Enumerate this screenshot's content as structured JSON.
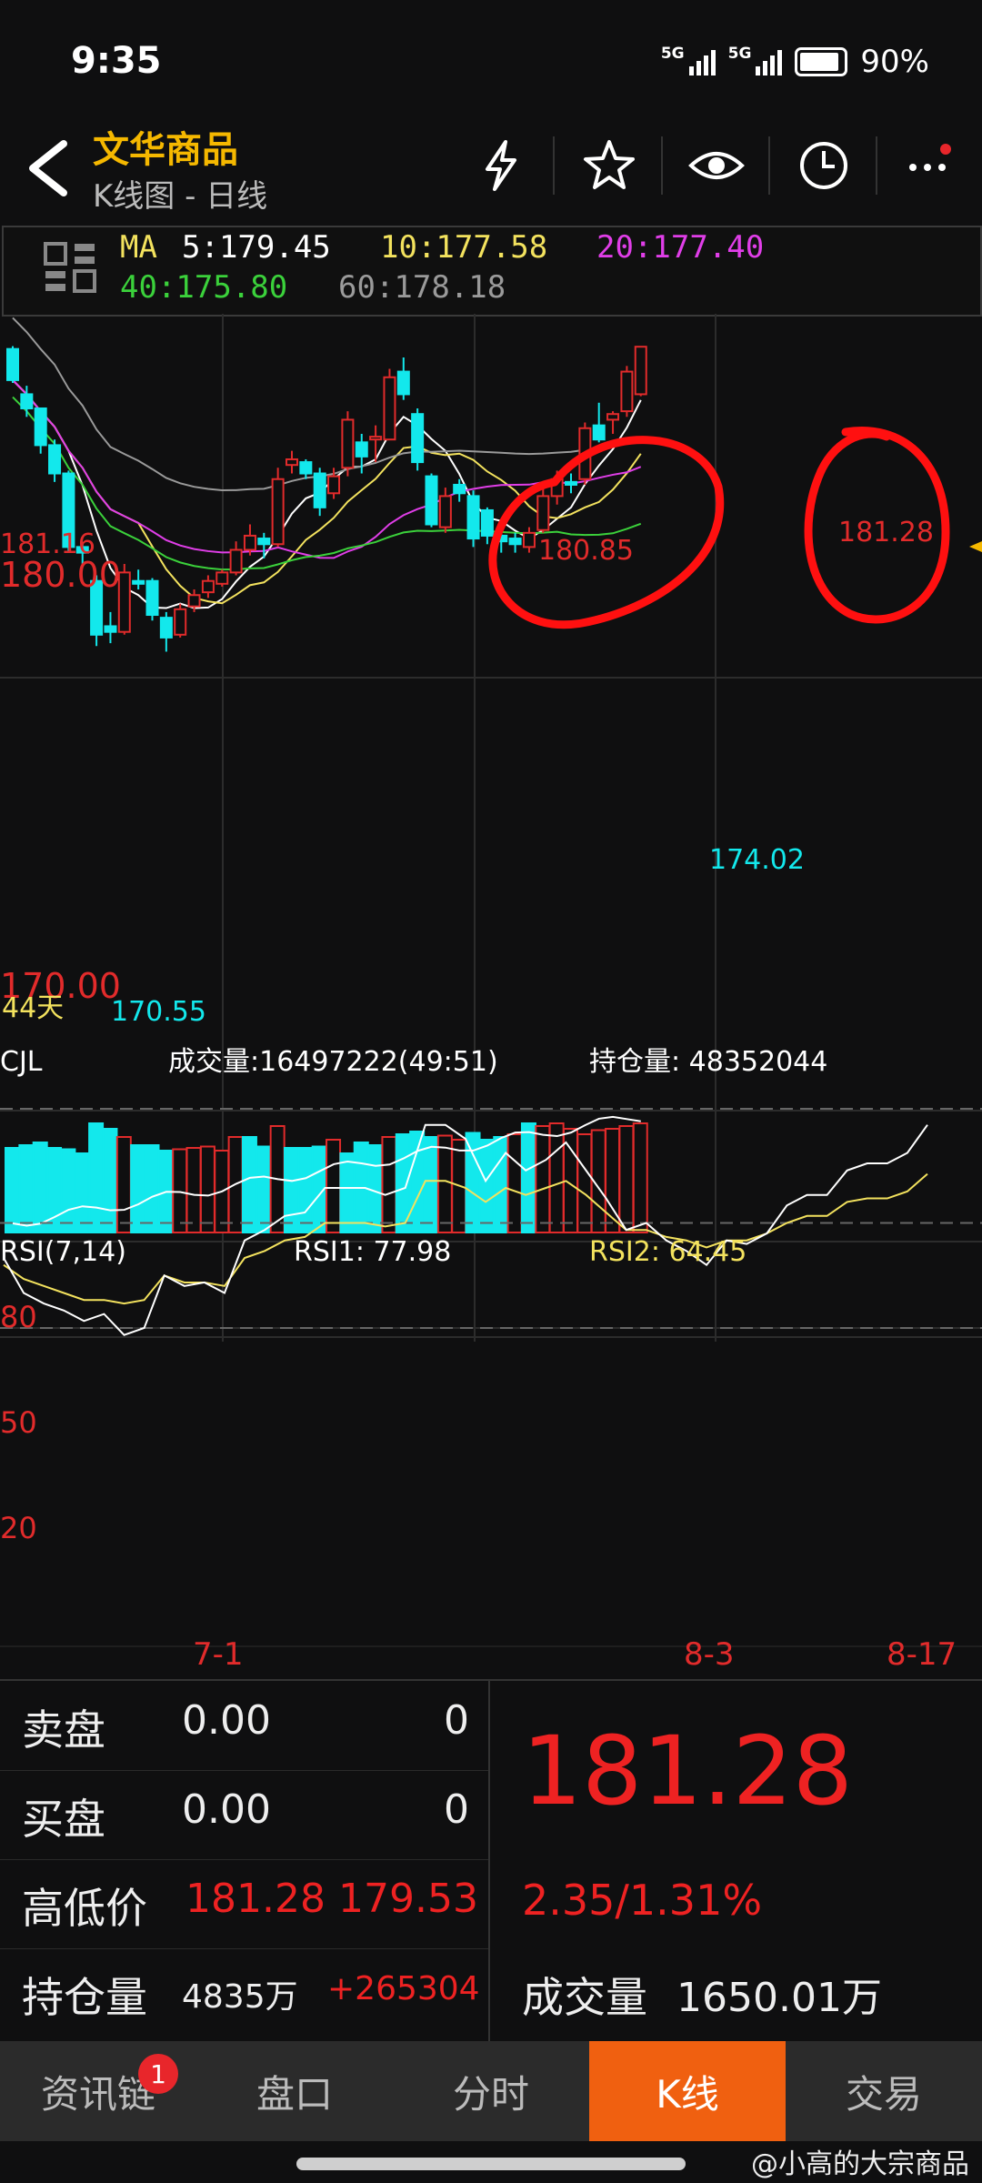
{
  "status": {
    "time": "9:35",
    "net1": "5G",
    "net2": "5G",
    "battery": "90%"
  },
  "header": {
    "title": "文华商品",
    "subtitle": "K线图 - 日线"
  },
  "ma": {
    "label": "MA",
    "ma5": "5:179.45",
    "ma10": "10:177.58",
    "ma20": "20:177.40",
    "ma40": "40:175.80",
    "ma60": "60:178.18"
  },
  "colors": {
    "ma5": "#ffffff",
    "ma10": "#f3e25e",
    "ma20": "#e03ee8",
    "ma40": "#3bd13b",
    "ma60": "#9a9a9a",
    "up": "#e12b2b",
    "down": "#13e8ec",
    "annot": "#ff1010"
  },
  "chart_labels": {
    "hi_left": "181.16",
    "p180": "180.00",
    "p170": "170.00",
    "days": "44天",
    "low1": "170.55",
    "low2": "174.02",
    "peak1": "180.85",
    "peak2": "181.28"
  },
  "volume": {
    "title": "CJL",
    "trade": "成交量:16497222(49:51)",
    "oi": "持仓量: 48352044"
  },
  "rsi": {
    "title": "RSI(7,14)",
    "rsi1": "RSI1: 77.98",
    "rsi2": "RSI2: 64.45",
    "l80": "80",
    "l50": "50",
    "l20": "20"
  },
  "xaxis": {
    "d1": "7-1",
    "d2": "8-3",
    "d3": "8-17"
  },
  "chart_data": {
    "type": "candlestick",
    "price_axis_labels": [
      180.0,
      170.0
    ],
    "ohlc": [
      [
        181.2,
        181.3,
        180.0,
        180.1
      ],
      [
        179.6,
        179.9,
        178.8,
        179.1
      ],
      [
        179.1,
        179.1,
        177.5,
        177.8
      ],
      [
        177.8,
        178.0,
        176.5,
        176.8
      ],
      [
        176.8,
        176.9,
        174.0,
        174.2
      ],
      [
        174.2,
        174.3,
        173.6,
        174.0
      ],
      [
        173.0,
        173.2,
        170.7,
        171.1
      ],
      [
        171.4,
        171.9,
        170.8,
        171.2
      ],
      [
        171.2,
        173.6,
        171.1,
        173.3
      ],
      [
        173.0,
        173.4,
        172.7,
        172.9
      ],
      [
        173.0,
        173.1,
        171.6,
        171.8
      ],
      [
        171.7,
        171.9,
        170.5,
        171.0
      ],
      [
        171.1,
        172.2,
        171.0,
        172.0
      ],
      [
        172.1,
        172.7,
        171.9,
        172.5
      ],
      [
        172.6,
        173.2,
        172.4,
        173.0
      ],
      [
        172.9,
        173.4,
        172.8,
        173.3
      ],
      [
        173.3,
        174.4,
        173.2,
        174.1
      ],
      [
        174.1,
        175.0,
        173.9,
        174.6
      ],
      [
        174.5,
        174.7,
        173.8,
        174.3
      ],
      [
        174.3,
        177.0,
        174.2,
        176.6
      ],
      [
        177.1,
        177.6,
        176.8,
        177.3
      ],
      [
        177.2,
        177.3,
        176.6,
        176.8
      ],
      [
        176.8,
        177.0,
        175.3,
        175.6
      ],
      [
        176.1,
        177.0,
        175.9,
        176.7
      ],
      [
        177.0,
        179.0,
        176.7,
        178.7
      ],
      [
        177.9,
        178.2,
        176.8,
        177.4
      ],
      [
        178.0,
        178.5,
        177.2,
        178.1
      ],
      [
        178.0,
        180.5,
        178.0,
        180.2
      ],
      [
        180.4,
        180.9,
        179.4,
        179.6
      ],
      [
        178.9,
        179.1,
        176.9,
        177.2
      ],
      [
        176.7,
        176.8,
        174.9,
        175.0
      ],
      [
        174.9,
        176.3,
        174.7,
        176.0
      ],
      [
        176.4,
        176.6,
        175.8,
        176.1
      ],
      [
        176.0,
        176.2,
        174.2,
        174.5
      ],
      [
        175.5,
        175.6,
        174.3,
        174.6
      ],
      [
        174.6,
        174.8,
        174.0,
        174.4
      ],
      [
        174.5,
        174.7,
        174.0,
        174.3
      ],
      [
        174.2,
        174.9,
        174.0,
        174.7
      ],
      [
        174.8,
        176.3,
        174.7,
        176.0
      ],
      [
        176.0,
        176.9,
        175.7,
        176.6
      ],
      [
        176.5,
        176.8,
        176.1,
        176.4
      ],
      [
        176.6,
        178.6,
        176.4,
        178.4
      ],
      [
        178.5,
        179.3,
        177.9,
        178.0
      ],
      [
        178.7,
        179.0,
        178.2,
        178.9
      ],
      [
        179.0,
        180.6,
        178.8,
        180.4
      ],
      [
        179.6,
        181.28,
        179.53,
        181.28
      ]
    ],
    "volume_up": [
      false,
      false,
      false,
      false,
      false,
      false,
      false,
      false,
      true,
      false,
      false,
      false,
      true,
      true,
      true,
      true,
      true,
      false,
      false,
      true,
      false,
      false,
      false,
      true,
      false,
      false,
      false,
      true,
      false,
      false,
      false,
      true,
      true,
      false,
      false,
      false,
      true,
      false,
      true,
      true,
      true,
      true,
      true,
      true,
      true,
      true
    ],
    "volume": [
      0.62,
      0.64,
      0.66,
      0.62,
      0.61,
      0.58,
      0.8,
      0.76,
      0.7,
      0.64,
      0.64,
      0.6,
      0.61,
      0.62,
      0.63,
      0.6,
      0.7,
      0.7,
      0.63,
      0.78,
      0.62,
      0.62,
      0.63,
      0.68,
      0.58,
      0.66,
      0.64,
      0.7,
      0.72,
      0.74,
      0.7,
      0.71,
      0.68,
      0.73,
      0.68,
      0.7,
      0.72,
      0.8,
      0.78,
      0.8,
      0.76,
      0.72,
      0.75,
      0.76,
      0.78,
      0.8
    ],
    "rsi1": [
      40,
      30,
      27,
      25,
      22,
      24,
      18,
      20,
      35,
      32,
      33,
      30,
      45,
      48,
      52,
      53,
      60,
      60,
      60,
      58,
      60,
      78,
      78,
      74,
      62,
      70,
      65,
      68,
      73,
      65,
      57,
      48,
      50,
      45,
      42,
      38,
      45,
      44,
      47,
      55,
      58,
      58,
      65,
      67,
      67,
      70,
      78
    ],
    "rsi2": [
      38,
      34,
      32,
      30,
      28,
      28,
      27,
      28,
      35,
      33,
      33,
      32,
      40,
      42,
      45,
      46,
      50,
      50,
      50,
      49,
      50,
      62,
      62,
      60,
      56,
      60,
      58,
      60,
      62,
      58,
      53,
      48,
      48,
      46,
      45,
      43,
      45,
      45,
      47,
      50,
      52,
      52,
      56,
      57,
      57,
      59,
      64
    ],
    "rsi_levels": [
      80,
      50,
      20
    ]
  },
  "panel": {
    "sell_label": "卖盘",
    "sell_price": "0.00",
    "sell_qty": "0",
    "buy_label": "买盘",
    "buy_price": "0.00",
    "buy_qty": "0",
    "hl_label": "高低价",
    "high": "181.28",
    "low": "179.53",
    "oi_label": "持仓量",
    "oi_value": "4835万",
    "oi_change": "+265304",
    "last_price": "181.28",
    "change": "2.35/1.31%",
    "vol_label": "成交量",
    "vol_value": "1650.01万"
  },
  "nav": {
    "tab1": "资讯链",
    "tab2": "盘口",
    "tab3": "分时",
    "tab4": "K线",
    "tab5": "交易",
    "badge": "1"
  },
  "watermark": "@小高的大宗商品"
}
